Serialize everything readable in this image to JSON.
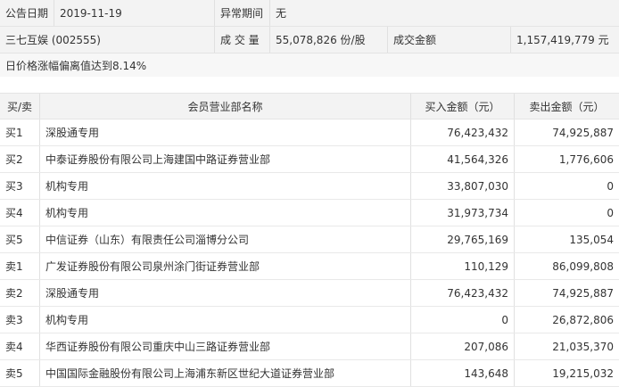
{
  "info": {
    "date_label": "公告日期",
    "date_value": "2019-11-19",
    "period_label": "异常期间",
    "period_value": "无",
    "stock_name": "三七互娱 (002555)",
    "volume_label": "成 交 量",
    "volume_value": "55,078,826 份/股",
    "amount_label": "成交金额",
    "amount_value": "1,157,419,779 元",
    "note": "日价格涨幅偏离值达到8.14%"
  },
  "table": {
    "headers": {
      "side": "买/卖",
      "broker": "会员营业部名称",
      "buy": "买入金额（元）",
      "sell": "卖出金额（元）"
    },
    "rows": [
      {
        "side": "买1",
        "broker": "深股通专用",
        "buy": "76,423,432",
        "sell": "74,925,887"
      },
      {
        "side": "买2",
        "broker": "中泰证券股份有限公司上海建国中路证券营业部",
        "buy": "41,564,326",
        "sell": "1,776,606"
      },
      {
        "side": "买3",
        "broker": "机构专用",
        "buy": "33,807,030",
        "sell": "0"
      },
      {
        "side": "买4",
        "broker": "机构专用",
        "buy": "31,973,734",
        "sell": "0"
      },
      {
        "side": "买5",
        "broker": "中信证券（山东）有限责任公司淄博分公司",
        "buy": "29,765,169",
        "sell": "135,054"
      },
      {
        "side": "卖1",
        "broker": "广发证券股份有限公司泉州涂门街证券营业部",
        "buy": "110,129",
        "sell": "86,099,808"
      },
      {
        "side": "卖2",
        "broker": "深股通专用",
        "buy": "76,423,432",
        "sell": "74,925,887"
      },
      {
        "side": "卖3",
        "broker": "机构专用",
        "buy": "0",
        "sell": "26,872,806"
      },
      {
        "side": "卖4",
        "broker": "华西证券股份有限公司重庆中山三路证券营业部",
        "buy": "207,086",
        "sell": "21,035,370"
      },
      {
        "side": "卖5",
        "broker": "中国国际金融股份有限公司上海浦东新区世纪大道证券营业部",
        "buy": "143,648",
        "sell": "19,215,032"
      }
    ]
  }
}
